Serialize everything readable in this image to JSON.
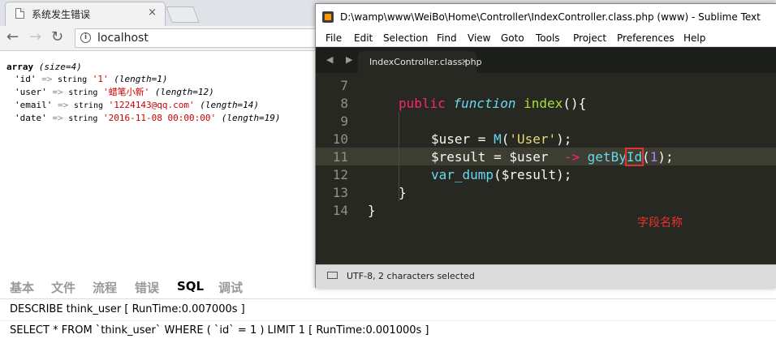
{
  "browser": {
    "tab_title": "系统发生错误",
    "tab_close": "×",
    "url": "localhost"
  },
  "dump": {
    "header_keyword": "array",
    "header_meta": "(size=4)",
    "rows": [
      {
        "key": "'id'",
        "arrow": "=>",
        "type": "string",
        "value": "'1'",
        "meta": "(length=1)"
      },
      {
        "key": "'user'",
        "arrow": "=>",
        "type": "string",
        "value": "'蜡笔小新'",
        "meta": "(length=12)"
      },
      {
        "key": "'email'",
        "arrow": "=>",
        "type": "string",
        "value": "'1224143@qq.com'",
        "meta": "(length=14)"
      },
      {
        "key": "'date'",
        "arrow": "=>",
        "type": "string",
        "value": "'2016-11-08 00:00:00'",
        "meta": "(length=19)"
      }
    ]
  },
  "trace": {
    "tabs": [
      "基本",
      "文件",
      "流程",
      "错误",
      "SQL",
      "调试"
    ],
    "active_tab": "SQL",
    "lines": [
      "DESCRIBE think_user [ RunTime:0.007000s ]",
      "SELECT * FROM `think_user` WHERE ( `id` = 1 ) LIMIT 1 [ RunTime:0.001000s ]"
    ]
  },
  "sublime": {
    "window_title": "D:\\wamp\\www\\WeiBo\\Home\\Controller\\IndexController.class.php (www) - Sublime Text",
    "menu": [
      "File",
      "Edit",
      "Selection",
      "Find",
      "View",
      "Goto",
      "Tools",
      "Project",
      "Preferences",
      "Help"
    ],
    "tab_arrows": "◀ ▶",
    "file_tab": "IndexController.class.php",
    "file_tab_close": "×",
    "line_numbers": [
      "7",
      "8",
      "9",
      "10",
      "11",
      "12",
      "13",
      "14"
    ],
    "code": {
      "l8_kw": "public",
      "l8_fnkw": "function",
      "l8_name": "index",
      "l8_rest": "(){",
      "l10_var": "$user = ",
      "l10_call": "M",
      "l10_p1": "(",
      "l10_str": "'User'",
      "l10_p2": ");",
      "l11_var": "$result = $user",
      "l11_arrow": "  ->",
      "l11_call1": " getBy",
      "l11_sel": "Id",
      "l11_p1": "(",
      "l11_num": "1",
      "l11_p2": ");",
      "l12_call": "var_dump",
      "l12_rest": "($result);",
      "l13": "}",
      "l14": "}"
    },
    "annotation": "字段名称",
    "status": "UTF-8, 2 characters selected"
  },
  "colors": {
    "editor_bg": "#272822",
    "keyword": "#f92672",
    "function": "#a6e22e",
    "string": "#e6db74",
    "number": "#ae81ff",
    "annotation": "#e8322d"
  }
}
